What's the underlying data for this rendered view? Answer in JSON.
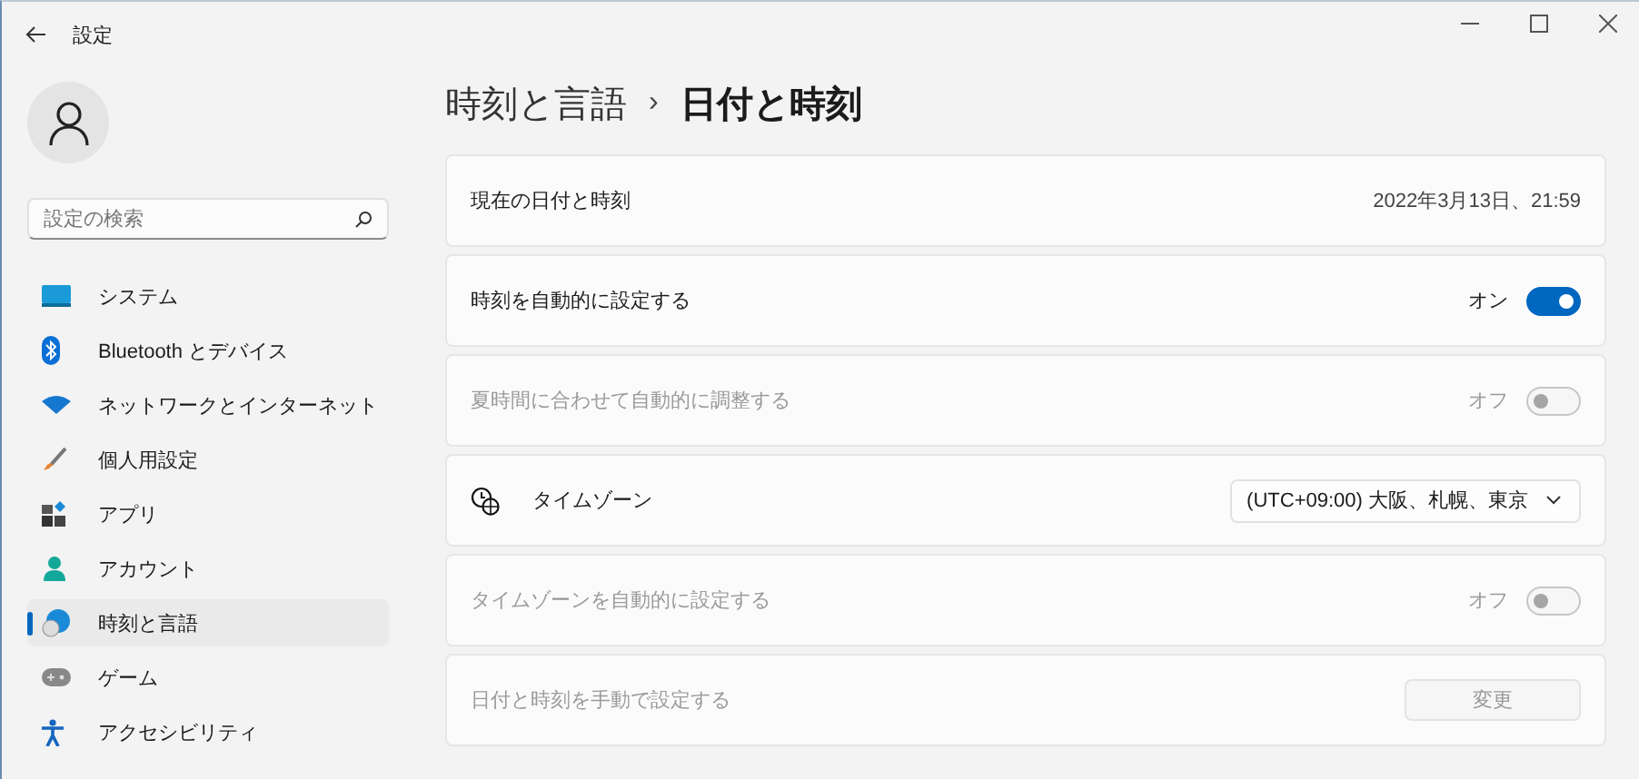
{
  "window": {
    "title": "設定"
  },
  "search": {
    "placeholder": "設定の検索"
  },
  "nav": [
    {
      "label": "システム",
      "selected": false
    },
    {
      "label": "Bluetooth とデバイス",
      "selected": false
    },
    {
      "label": "ネットワークとインターネット",
      "selected": false
    },
    {
      "label": "個人用設定",
      "selected": false
    },
    {
      "label": "アプリ",
      "selected": false
    },
    {
      "label": "アカウント",
      "selected": false
    },
    {
      "label": "時刻と言語",
      "selected": true
    },
    {
      "label": "ゲーム",
      "selected": false
    },
    {
      "label": "アクセシビリティ",
      "selected": false
    }
  ],
  "breadcrumb": {
    "parent": "時刻と言語",
    "separator": "›",
    "current": "日付と時刻"
  },
  "settings": [
    {
      "kind": "value",
      "label": "現在の日付と時刻",
      "value": "2022年3月13日、21:59",
      "disabled": false
    },
    {
      "kind": "toggle",
      "label": "時刻を自動的に設定する",
      "state_label": "オン",
      "on": true,
      "disabled": false
    },
    {
      "kind": "toggle",
      "label": "夏時間に合わせて自動的に調整する",
      "state_label": "オフ",
      "on": false,
      "disabled": true
    },
    {
      "kind": "dropdown",
      "label": "タイムゾーン",
      "value": "(UTC+09:00) 大阪、札幌、東京",
      "disabled": false
    },
    {
      "kind": "toggle",
      "label": "タイムゾーンを自動的に設定する",
      "state_label": "オフ",
      "on": false,
      "disabled": true
    },
    {
      "kind": "button",
      "label": "日付と時刻を手動で設定する",
      "button": "変更",
      "disabled": true
    }
  ]
}
